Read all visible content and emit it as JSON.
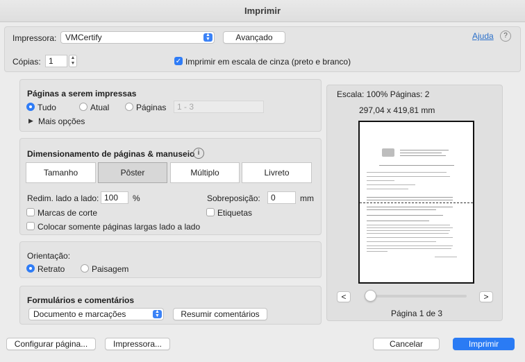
{
  "window": {
    "title": "Imprimir"
  },
  "header": {
    "printer_label": "Impressora:",
    "printer_value": "VMCertify",
    "advanced_label": "Avançado",
    "help_label": "Ajuda",
    "help_glyph": "?",
    "copies_label": "Cópias:",
    "copies_value": "1",
    "grayscale_label": "Imprimir em escala de cinza (preto e branco)",
    "grayscale_checked": true
  },
  "pages_section": {
    "title": "Páginas a serem impressas",
    "opt_all": "Tudo",
    "opt_current": "Atual",
    "opt_pages": "Páginas",
    "pages_placeholder": "1 - 3",
    "more_options": "Mais opções"
  },
  "sizing_section": {
    "title": "Dimensionamento de páginas & manuseio",
    "tabs": [
      "Tamanho",
      "Pôster",
      "Múltiplo",
      "Livreto"
    ],
    "active_tab": "Pôster",
    "tile_scale_label": "Redim. lado a lado:",
    "tile_scale_value": "100",
    "tile_scale_unit": "%",
    "overlap_label": "Sobreposição:",
    "overlap_value": "0",
    "overlap_unit": "mm",
    "cut_marks_label": "Marcas de corte",
    "labels_label": "Etiquetas",
    "large_pages_label": "Colocar somente páginas largas lado a lado"
  },
  "orientation_section": {
    "title": "Orientação:",
    "portrait": "Retrato",
    "landscape": "Paisagem"
  },
  "forms_section": {
    "title": "Formulários e comentários",
    "select_value": "Documento e marcações",
    "summarize_label": "Resumir comentários"
  },
  "preview": {
    "scale_text": "Escala: 100% Páginas: 2",
    "dimensions": "297,04 x 419,81 mm",
    "prev_glyph": "<",
    "next_glyph": ">",
    "page_indicator": "Página 1 de 3"
  },
  "footer": {
    "page_setup": "Configurar página...",
    "printer": "Impressora...",
    "cancel": "Cancelar",
    "print": "Imprimir"
  },
  "colors": {
    "accent": "#2a7bf4",
    "link": "#2a6fc9"
  }
}
